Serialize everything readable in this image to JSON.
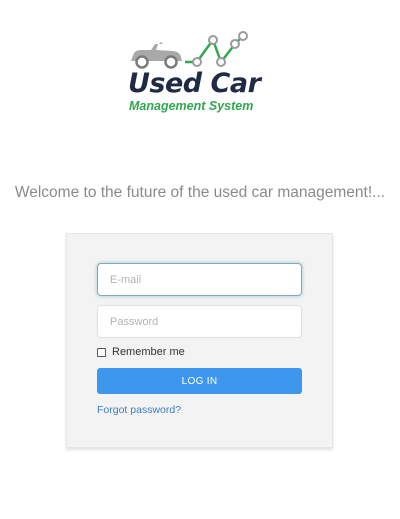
{
  "logo": {
    "title": "Used Car",
    "subtitle": "Management System",
    "car_icon": "car-icon",
    "graph_icon": "line-graph-icon",
    "colors": {
      "title": "#1f2a44",
      "subtitle": "#2fa84f",
      "car": "#a9a9a9"
    }
  },
  "welcome_text": "Welcome to the future of the used car management!...",
  "login_form": {
    "email_placeholder": "E-mail",
    "email_value": "",
    "password_placeholder": "Password",
    "password_value": "",
    "remember_label": "Remember me",
    "remember_checked": false,
    "login_button_label": "LOG IN",
    "forgot_link": "Forgot password?",
    "colors": {
      "button": "#3d97ec",
      "link": "#3a7fc1",
      "card": "#f3f3f3"
    }
  }
}
